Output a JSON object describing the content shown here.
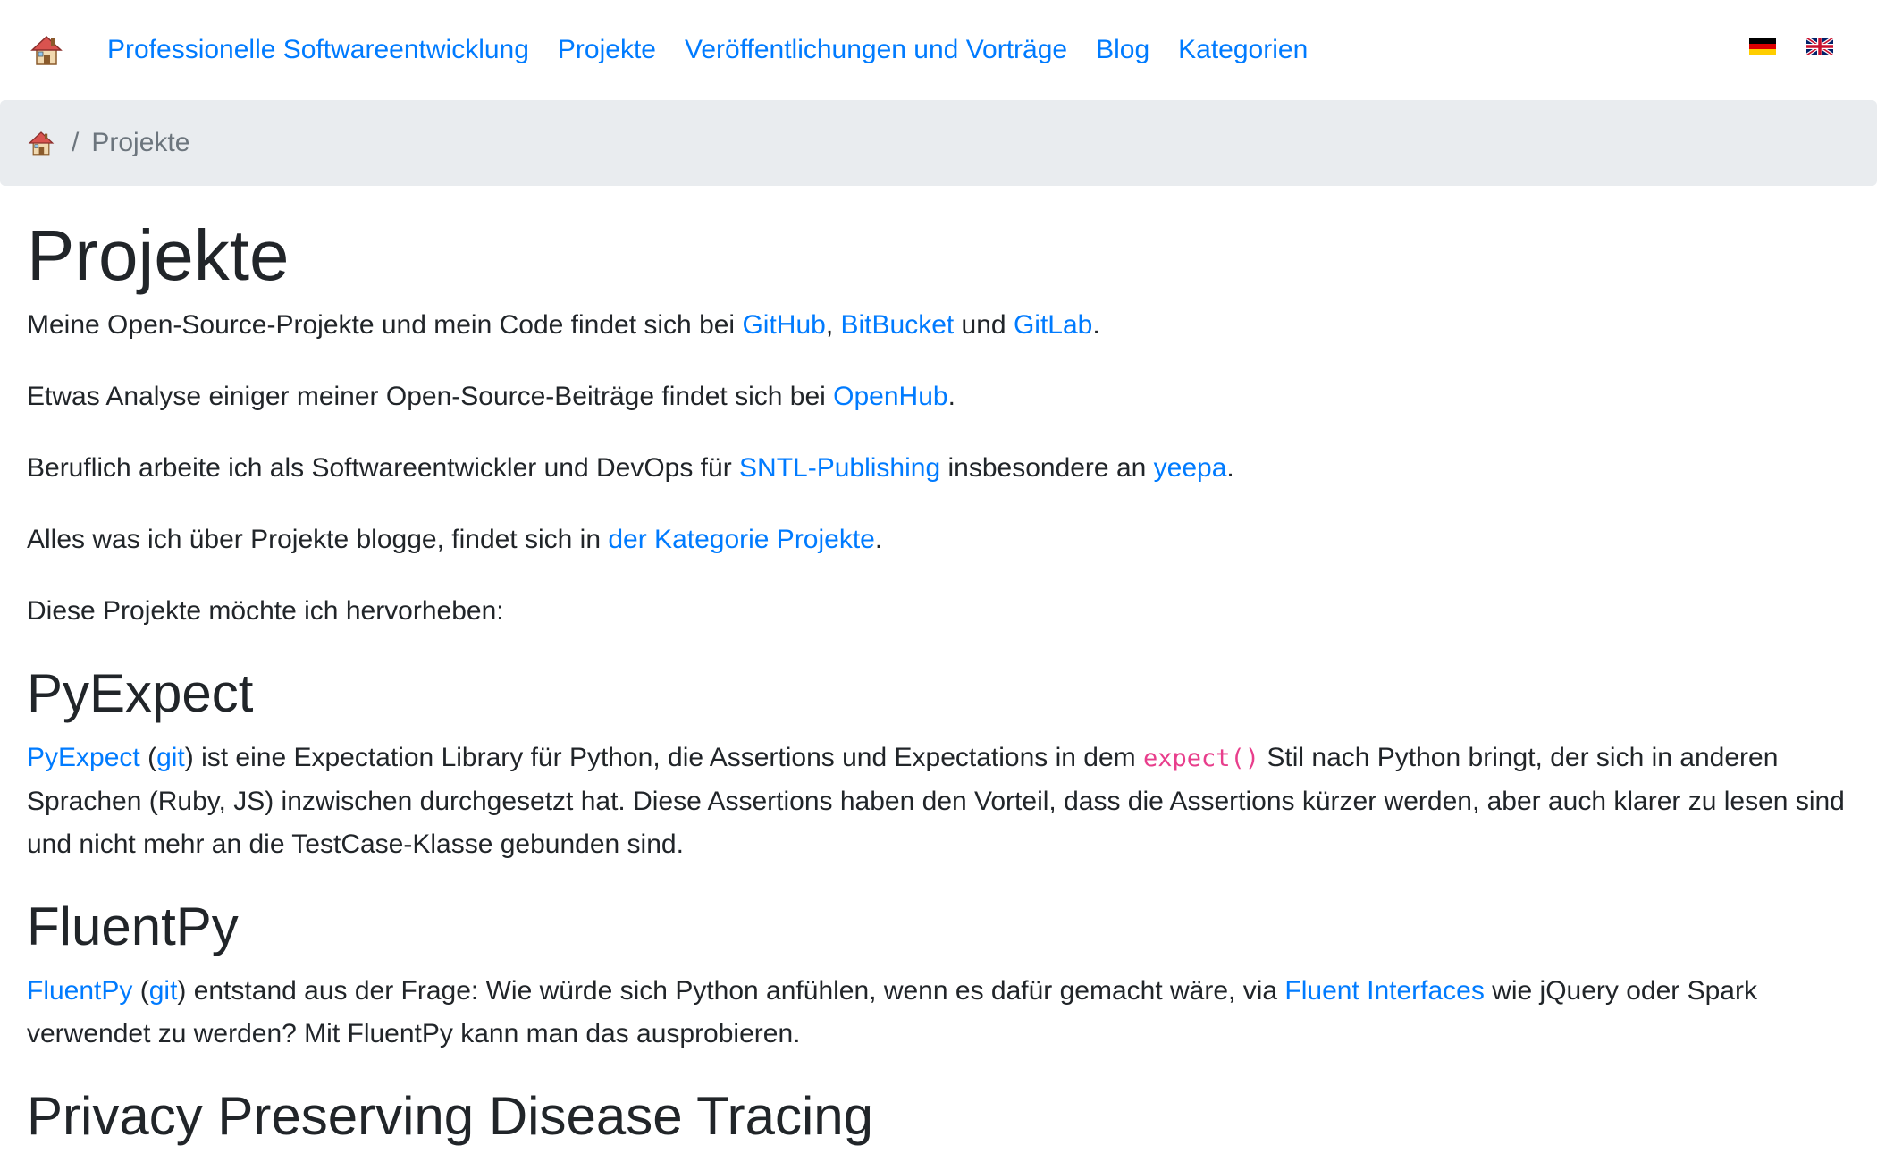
{
  "nav": {
    "links": [
      "Professionelle Softwareentwicklung",
      "Projekte",
      "Veröffentlichungen und Vorträge",
      "Blog",
      "Kategorien"
    ]
  },
  "breadcrumb": {
    "separator": "/",
    "current": "Projekte"
  },
  "page": {
    "title": "Projekte",
    "intro1": {
      "pre": "Meine Open-Source-Projekte und mein Code findet sich bei ",
      "link1": "GitHub",
      "sep": ", ",
      "link2": "BitBucket",
      "mid": " und ",
      "link3": "GitLab",
      "post": "."
    },
    "intro2": {
      "pre": "Etwas Analyse einiger meiner Open-Source-Beiträge findet sich bei ",
      "link": "OpenHub",
      "post": "."
    },
    "intro3": {
      "pre": "Beruflich arbeite ich als Softwareentwickler und DevOps für ",
      "link1": "SNTL-Publishing",
      "mid": " insbesondere an ",
      "link2": "yeepa",
      "post": "."
    },
    "intro4": {
      "pre": "Alles was ich über Projekte blogge, findet sich in ",
      "link": "der Kategorie Projekte",
      "post": "."
    },
    "intro5": "Diese Projekte möchte ich hervorheben:"
  },
  "sections": {
    "pyexpect": {
      "title": "PyExpect",
      "link": "PyExpect",
      "open": " (",
      "git": "git",
      "text1": ") ist eine Expectation Library für Python, die Assertions und Expectations in dem ",
      "code": "expect()",
      "text2": " Stil nach Python bringt, der sich in anderen Sprachen (Ruby, JS) inzwischen durchgesetzt hat. Diese Assertions haben den Vorteil, dass die Assertions kürzer werden, aber auch klarer zu lesen sind und nicht mehr an die TestCase-Klasse gebunden sind."
    },
    "fluentpy": {
      "title": "FluentPy",
      "link": "FluentPy",
      "open": " (",
      "git": "git",
      "text1": ") entstand aus der Frage: Wie würde sich Python anfühlen, wenn es dafür gemacht wäre, via ",
      "link2": "Fluent Interfaces",
      "text2": " wie jQuery oder Spark verwendet zu werden? Mit FluentPy kann man das ausprobieren."
    },
    "privacy": {
      "title": "Privacy Preserving Disease Tracing"
    }
  },
  "icons": {
    "home": "home-icon",
    "flag_de": "flag-de-icon",
    "flag_en": "flag-uk-icon"
  }
}
